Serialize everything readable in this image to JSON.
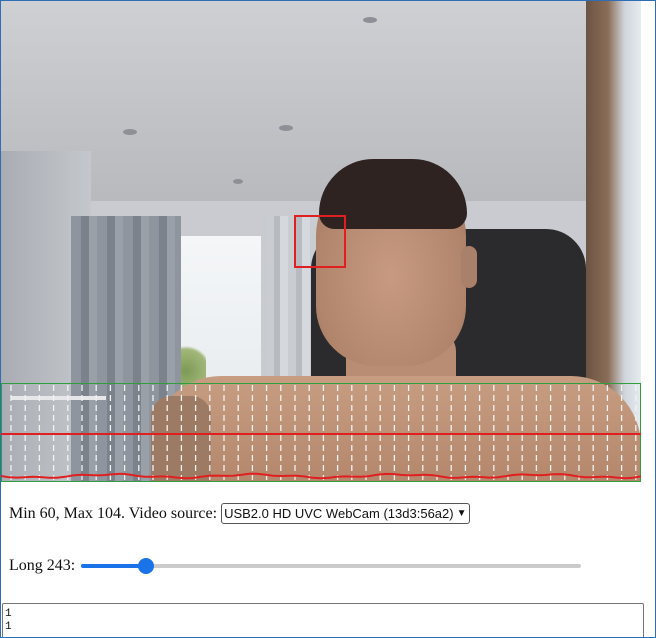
{
  "video": {
    "scene": "webcam-feed",
    "face_box_color": "#e02020",
    "signal_frame_color": "#2e9e3e",
    "signal_colors": {
      "marker_lines": "#f2f2f2",
      "trace": "#e02020"
    }
  },
  "controls": {
    "stats_text": "Min 60, Max 104. Video source:",
    "video_source": {
      "selected": "USB2.0 HD UVC WebCam (13d3:56a2)"
    },
    "long_label": "Long 243:",
    "long_slider": {
      "value": 243,
      "fraction": 0.13
    }
  },
  "log": {
    "lines": [
      "1",
      "1"
    ]
  },
  "colors": {
    "accent": "#1a73e8",
    "window_border": "#2f6db5"
  }
}
